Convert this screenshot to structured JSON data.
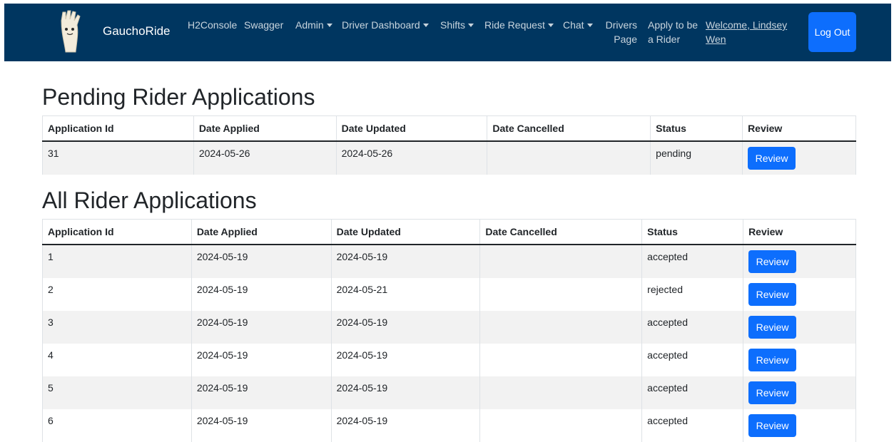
{
  "navbar": {
    "brand": "GauchoRide",
    "items": [
      {
        "label": "H2Console"
      },
      {
        "label": "Swagger"
      },
      {
        "label": "Admin"
      },
      {
        "label": "Driver Dashboard"
      },
      {
        "label": "Shifts"
      },
      {
        "label": "Ride Request"
      },
      {
        "label": "Chat"
      },
      {
        "label": "Drivers Page"
      },
      {
        "label": "Apply to be a Rider"
      }
    ],
    "welcome": "Welcome, Lindsey Wen",
    "logout": "Log Out",
    "colors": {
      "background": "#003660",
      "button": "#0d6efd"
    }
  },
  "pending": {
    "title": "Pending Rider Applications",
    "headers": [
      "Application Id",
      "Date Applied",
      "Date Updated",
      "Date Cancelled",
      "Status",
      "Review"
    ],
    "rows": [
      {
        "id": "31",
        "applied": "2024-05-26",
        "updated": "2024-05-26",
        "cancelled": "",
        "status": "pending",
        "review": "Review"
      }
    ]
  },
  "all": {
    "title": "All Rider Applications",
    "headers": [
      "Application Id",
      "Date Applied",
      "Date Updated",
      "Date Cancelled",
      "Status",
      "Review"
    ],
    "rows": [
      {
        "id": "1",
        "applied": "2024-05-19",
        "updated": "2024-05-19",
        "cancelled": "",
        "status": "accepted",
        "review": "Review"
      },
      {
        "id": "2",
        "applied": "2024-05-19",
        "updated": "2024-05-21",
        "cancelled": "",
        "status": "rejected",
        "review": "Review"
      },
      {
        "id": "3",
        "applied": "2024-05-19",
        "updated": "2024-05-19",
        "cancelled": "",
        "status": "accepted",
        "review": "Review"
      },
      {
        "id": "4",
        "applied": "2024-05-19",
        "updated": "2024-05-19",
        "cancelled": "",
        "status": "accepted",
        "review": "Review"
      },
      {
        "id": "5",
        "applied": "2024-05-19",
        "updated": "2024-05-19",
        "cancelled": "",
        "status": "accepted",
        "review": "Review"
      },
      {
        "id": "6",
        "applied": "2024-05-19",
        "updated": "2024-05-19",
        "cancelled": "",
        "status": "accepted",
        "review": "Review"
      }
    ]
  }
}
